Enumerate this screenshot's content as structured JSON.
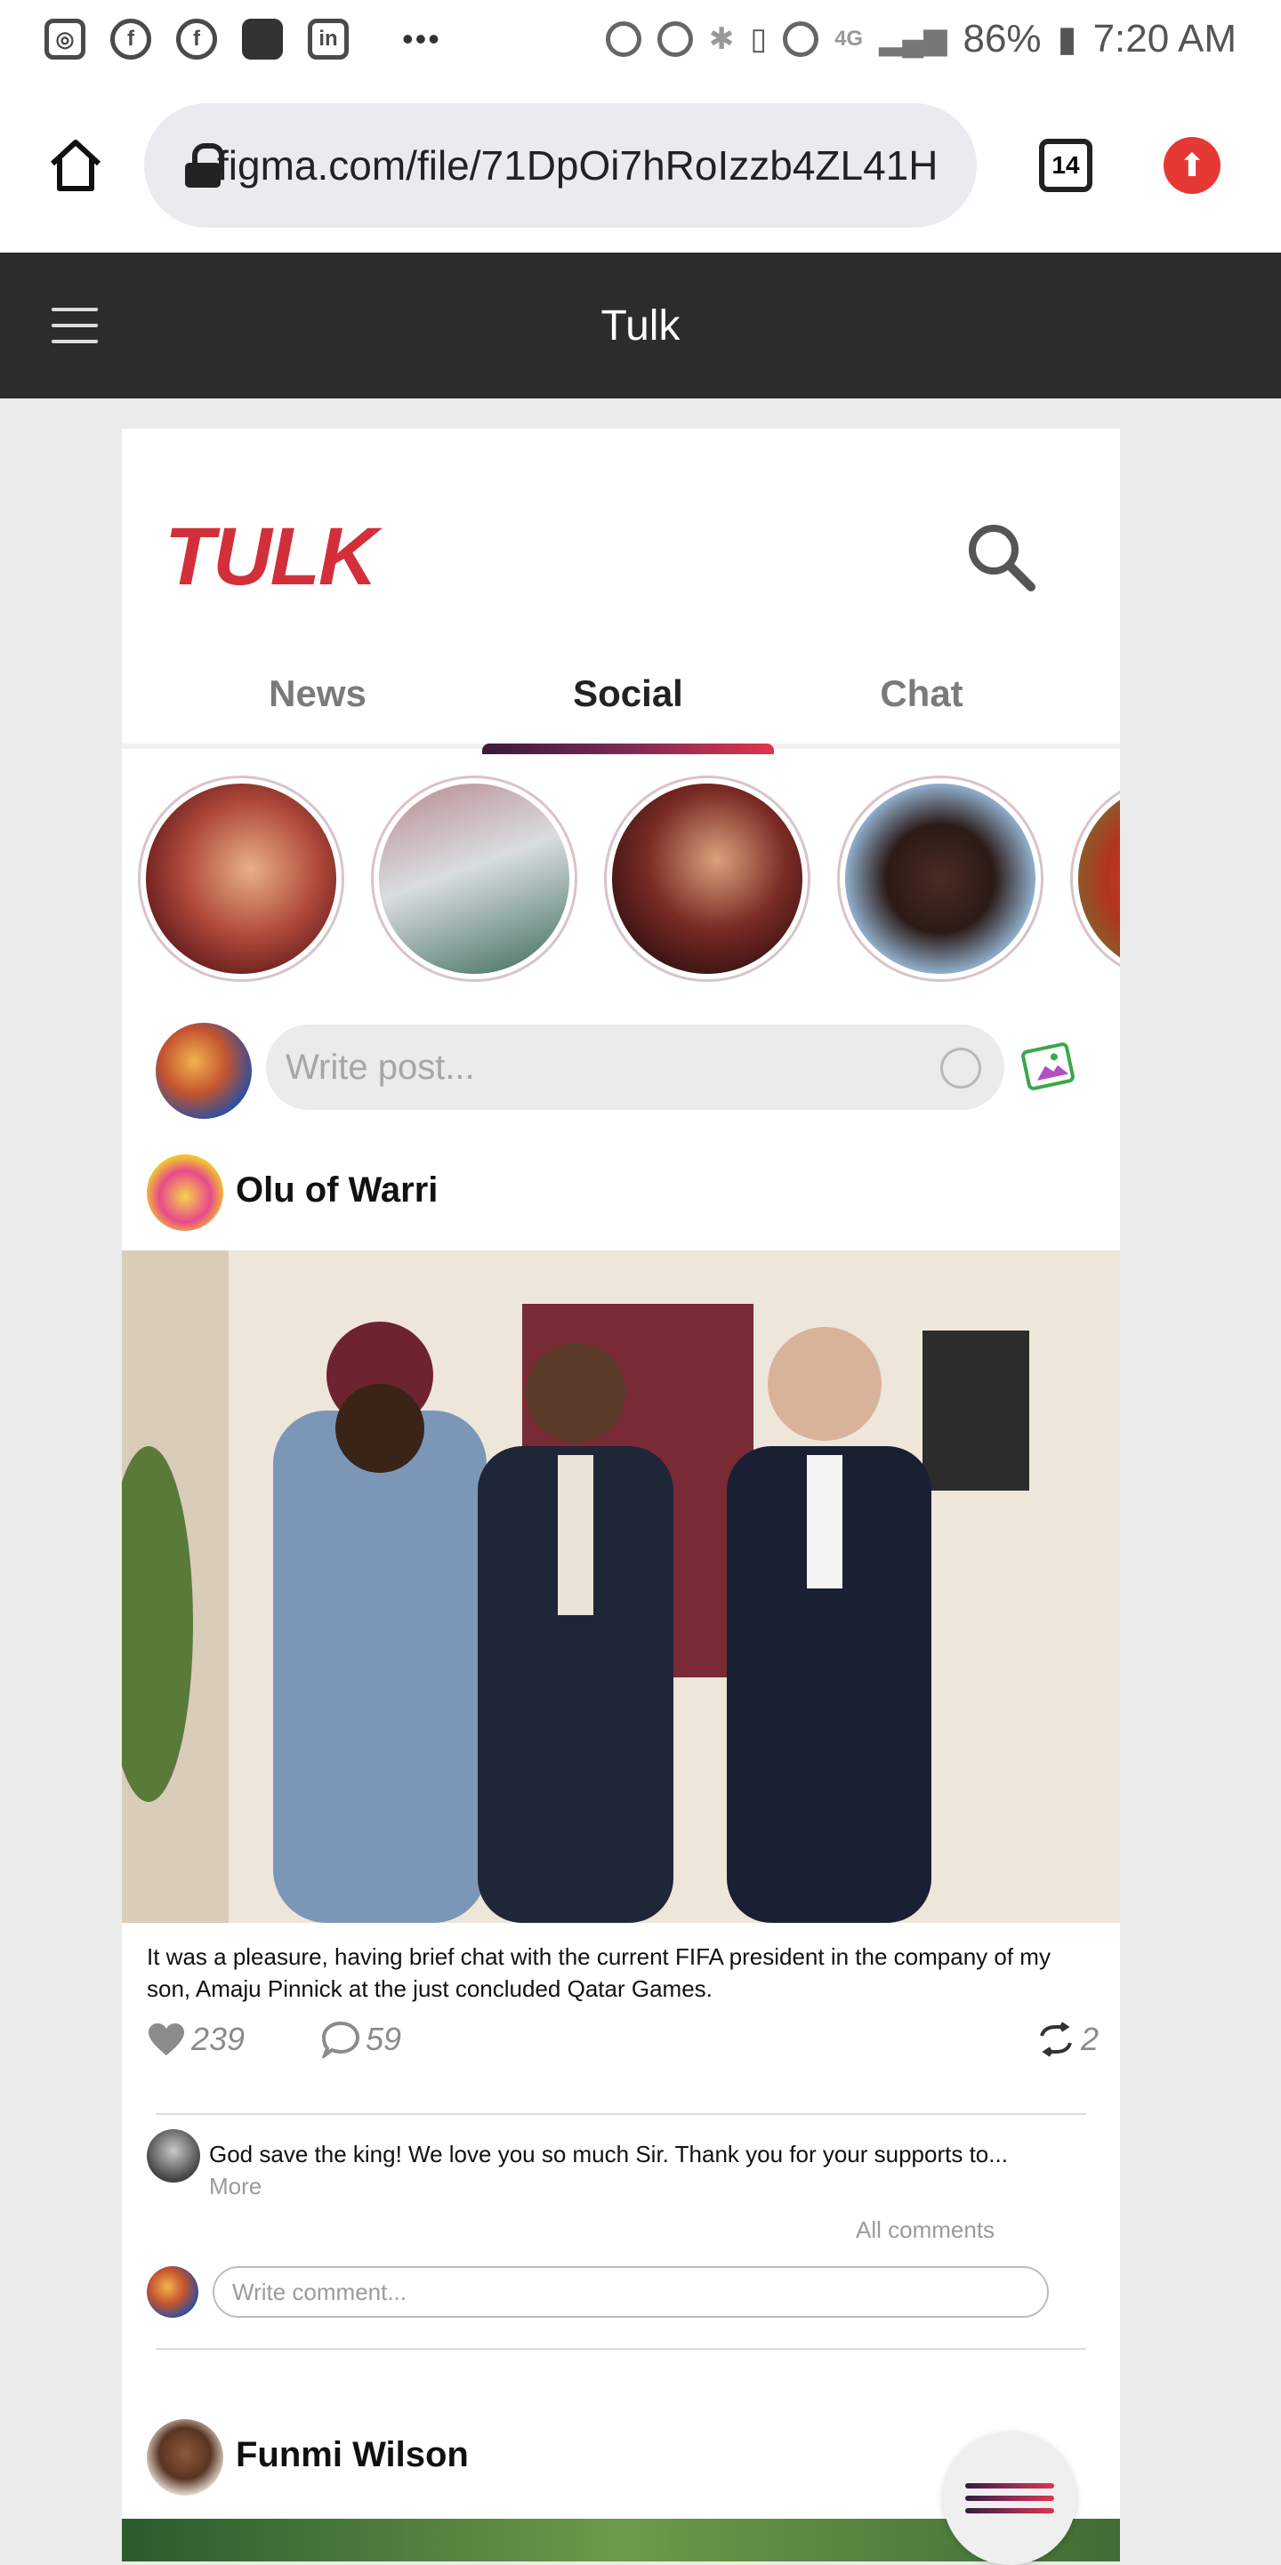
{
  "status_bar": {
    "battery": "86%",
    "time": "7:20 AM",
    "network": "4G"
  },
  "browser": {
    "url": "figma.com/file/71DpOi7hRoIzzb4ZL41H",
    "tab_count": "14"
  },
  "figma": {
    "title": "Tulk"
  },
  "app": {
    "logo": "TULK",
    "tabs": [
      {
        "label": "News"
      },
      {
        "label": "Social"
      },
      {
        "label": "Chat"
      }
    ],
    "active_tab": "Social",
    "composer_placeholder": "Write post...",
    "posts": [
      {
        "author": "Olu of Warri",
        "caption": "It was a pleasure, having brief chat with the current FIFA president in the company of my son, Amaju Pinnick at the just concluded Qatar Games.",
        "likes": "239",
        "comments": "59",
        "reposts": "2",
        "top_comment": "God save the king! We love you so much Sir. Thank you for your supports to...",
        "more_label": "More",
        "all_comments_label": "All comments",
        "comment_placeholder": "Write comment..."
      },
      {
        "author": "Funmi Wilson"
      }
    ]
  },
  "colors": {
    "brand": "#d32f3a",
    "dark_bar": "#2c2c2c",
    "update_button": "#e53935"
  },
  "icons": [
    "instagram-icon",
    "facebook-icon",
    "linkedin-icon",
    "home-icon",
    "lock-icon",
    "update-icon",
    "menu-icon",
    "search-icon",
    "smiley-icon",
    "photo-icon",
    "heart-icon",
    "comment-icon",
    "repost-icon"
  ]
}
